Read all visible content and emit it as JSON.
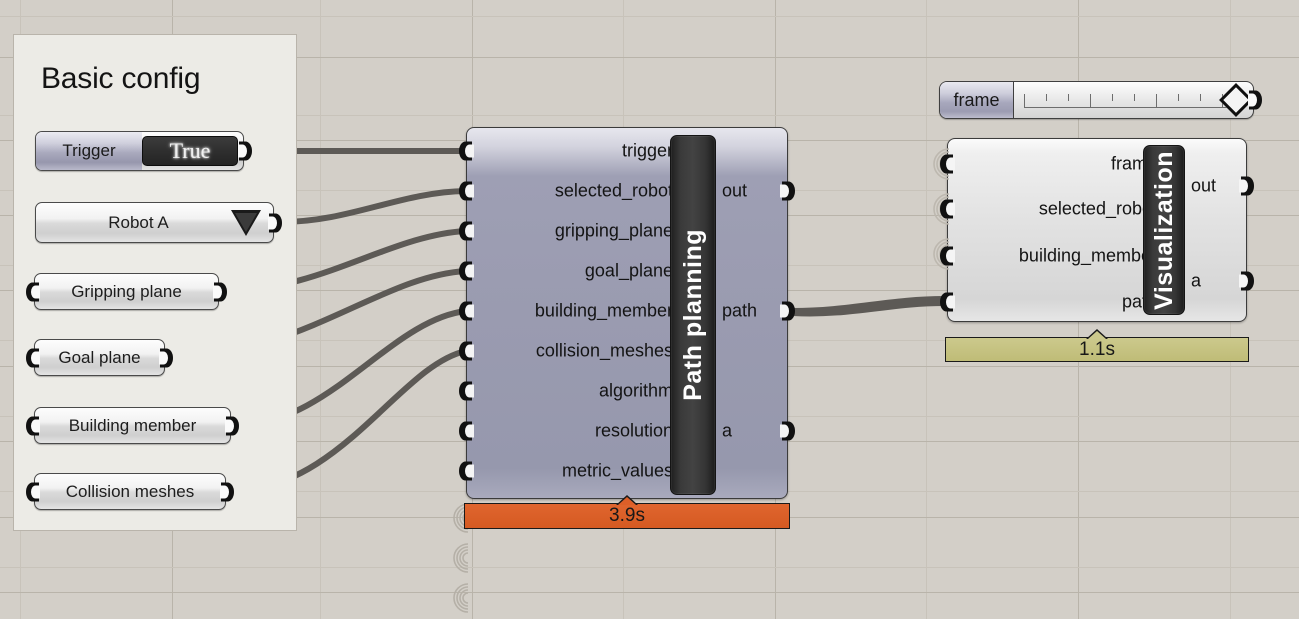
{
  "canvas": {
    "background_color": "#d3cfc8",
    "grid_line_color": "#c8c3ba",
    "grid_major_color": "#b9b4aa"
  },
  "group_panel": {
    "title": "Basic config",
    "background_color": "#ecebe6",
    "border_color": "#b9b4ab"
  },
  "params": [
    {
      "name": "trigger-toggle",
      "type": "boolean_toggle",
      "label": "Trigger",
      "value": "True"
    },
    {
      "name": "robot-value-list",
      "type": "value_list",
      "label": "Robot A",
      "icon": "chevron-down-icon"
    },
    {
      "name": "gripping-plane-param",
      "type": "param",
      "label": "Gripping plane"
    },
    {
      "name": "goal-plane-param",
      "type": "param",
      "label": "Goal plane"
    },
    {
      "name": "building-member-param",
      "type": "param",
      "label": "Building member"
    },
    {
      "name": "collision-meshes-param",
      "type": "param",
      "label": "Collision meshes"
    }
  ],
  "slider": {
    "label": "frame",
    "handle_position_percent": 95,
    "tick_count": 11
  },
  "components": [
    {
      "id": "path-planning",
      "title": "Path planning",
      "accent_color": "#dd5f28",
      "runtime": "3.9s",
      "inputs": [
        "trigger",
        "selected_robot",
        "gripping_plane",
        "goal_plane",
        "building_member",
        "collision_meshes",
        "algorithm",
        "resolution",
        "metric_values"
      ],
      "outputs": [
        "out",
        "path",
        "a"
      ]
    },
    {
      "id": "visualization",
      "title": "Visualization",
      "accent_color": "#c3c07e",
      "runtime": "1.1s",
      "inputs": [
        "frame",
        "selected_robot",
        "building_member",
        "path"
      ],
      "outputs": [
        "out",
        "a"
      ]
    }
  ]
}
